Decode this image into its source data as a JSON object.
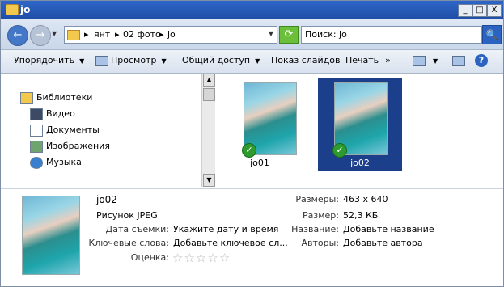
{
  "window": {
    "title": "jo",
    "minimize": "_",
    "maximize": "□",
    "close": "X"
  },
  "addressbar": {
    "breadcrumbs": [
      "янт",
      "02 фото",
      "jo"
    ],
    "search_value": "Поиск: jo"
  },
  "toolbar": {
    "organize": "Упорядочить",
    "preview": "Просмотр",
    "share": "Общий доступ",
    "slideshow": "Показ слайдов",
    "print": "Печать",
    "more": "»"
  },
  "nav": {
    "libraries": "Библиотеки",
    "items": [
      "Видео",
      "Документы",
      "Изображения",
      "Музыка"
    ]
  },
  "files": [
    {
      "name": "jo01",
      "selected": false
    },
    {
      "name": "jo02",
      "selected": true
    }
  ],
  "details": {
    "name": "jo02",
    "type": "Рисунок JPEG",
    "date_label": "Дата съемки:",
    "date_value": "Укажите дату и время",
    "keywords_label": "Ключевые слова:",
    "keywords_value": "Добавьте ключевое сл...",
    "rating_label": "Оценка:",
    "rating_stars": 0,
    "dimensions_label": "Размеры:",
    "dimensions_value": "463 x 640",
    "size_label": "Размер:",
    "size_value": "52,3 КБ",
    "title_label": "Название:",
    "title_value": "Добавьте название",
    "authors_label": "Авторы:",
    "authors_value": "Добавьте автора"
  },
  "icons": {
    "back": "←",
    "forward": "→",
    "refresh": "⟳",
    "search": "🔍",
    "help": "?",
    "check": "✓",
    "star": "☆"
  },
  "colors": {
    "titlebar": "#2f66c8",
    "selection": "#1c3f8c",
    "check_green": "#2e9b2e"
  }
}
